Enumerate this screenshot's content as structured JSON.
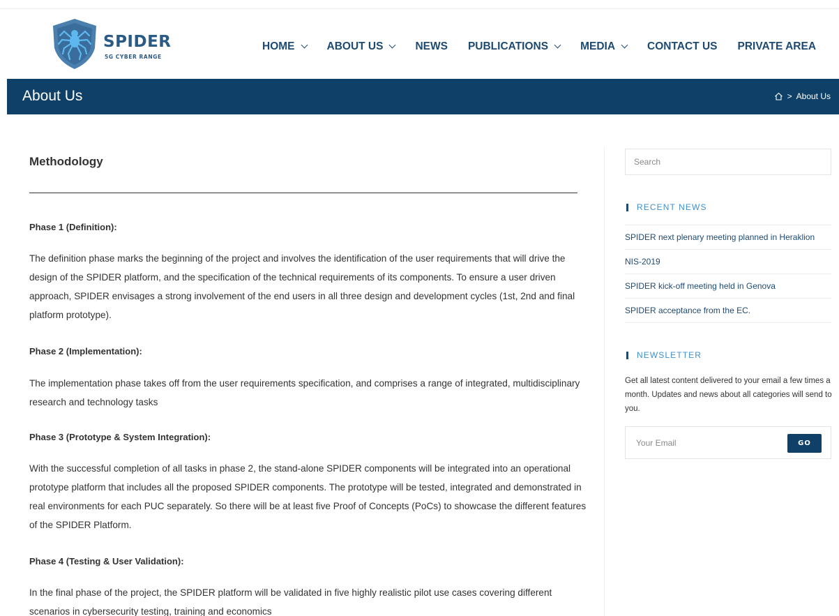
{
  "brand": {
    "name": "SPIDER",
    "tagline": "5G CYBER RANGE",
    "colors": {
      "primary": "#0f4168",
      "accent": "#3f8fcf",
      "shield": "#4a7fae"
    }
  },
  "nav": {
    "items": [
      {
        "label": "HOME",
        "dropdown": true
      },
      {
        "label": "ABOUT US",
        "dropdown": true
      },
      {
        "label": "NEWS",
        "dropdown": false
      },
      {
        "label": "PUBLICATIONS",
        "dropdown": true
      },
      {
        "label": "MEDIA",
        "dropdown": true
      },
      {
        "label": "CONTACT US",
        "dropdown": false
      },
      {
        "label": "PRIVATE AREA",
        "dropdown": false
      }
    ]
  },
  "titlebar": {
    "title": "About Us",
    "breadcrumb_sep": ">",
    "breadcrumb_current": "About Us",
    "home_icon": "home-icon"
  },
  "main": {
    "heading": "Methodology",
    "phases": [
      {
        "title": "Phase 1 (Definition):",
        "text": "The definition phase marks the beginning of the project and involves the identification of the user requirements that will drive the design of the SPIDER platform, and the specification of the technical requirements of its components. To ensure a user driven approach, SPIDER envisages a strong involvement of the end users in all three design and development cycles (1st, 2nd and final platform prototype)."
      },
      {
        "title": "Phase 2 (Implementation):",
        "text": "The implementation phase takes off from the user requirements specification, and comprises a range of integrated, multidisciplinary research and technology tasks"
      },
      {
        "title": "Phase 3 (Prototype & System Integration):",
        "text": "With the successful completion of all tasks in phase 2, the stand-alone SPIDER components will be integrated into an operational prototype platform that includes all the proposed SPIDER components. The prototype will be tested, integrated and demonstrated in real environments for each PUC separately. So there will be at least five Proof of Concepts (PoCs) to showcase the different features of the SPIDER Platform."
      },
      {
        "title": "Phase 4 (Testing & User Validation):",
        "text": "In the final phase of the project, the SPIDER platform will be validated in five highly realistic pilot use cases covering different scenarios in cybersecurity testing, training and economics"
      }
    ]
  },
  "sidebar": {
    "search": {
      "placeholder": "Search",
      "value": ""
    },
    "recent_news": {
      "title": "RECENT NEWS",
      "items": [
        "SPIDER next plenary meeting planned in Heraklion",
        "NIS-2019",
        "SPIDER kick-off meeting held in Genova",
        "SPIDER acceptance from the EC."
      ]
    },
    "newsletter": {
      "title": "NEWSLETTER",
      "text": "Get all latest content delivered to your email a few times a month. Updates and news about all categories will send to you.",
      "email_placeholder": "Your Email",
      "button_label": "GO"
    }
  }
}
